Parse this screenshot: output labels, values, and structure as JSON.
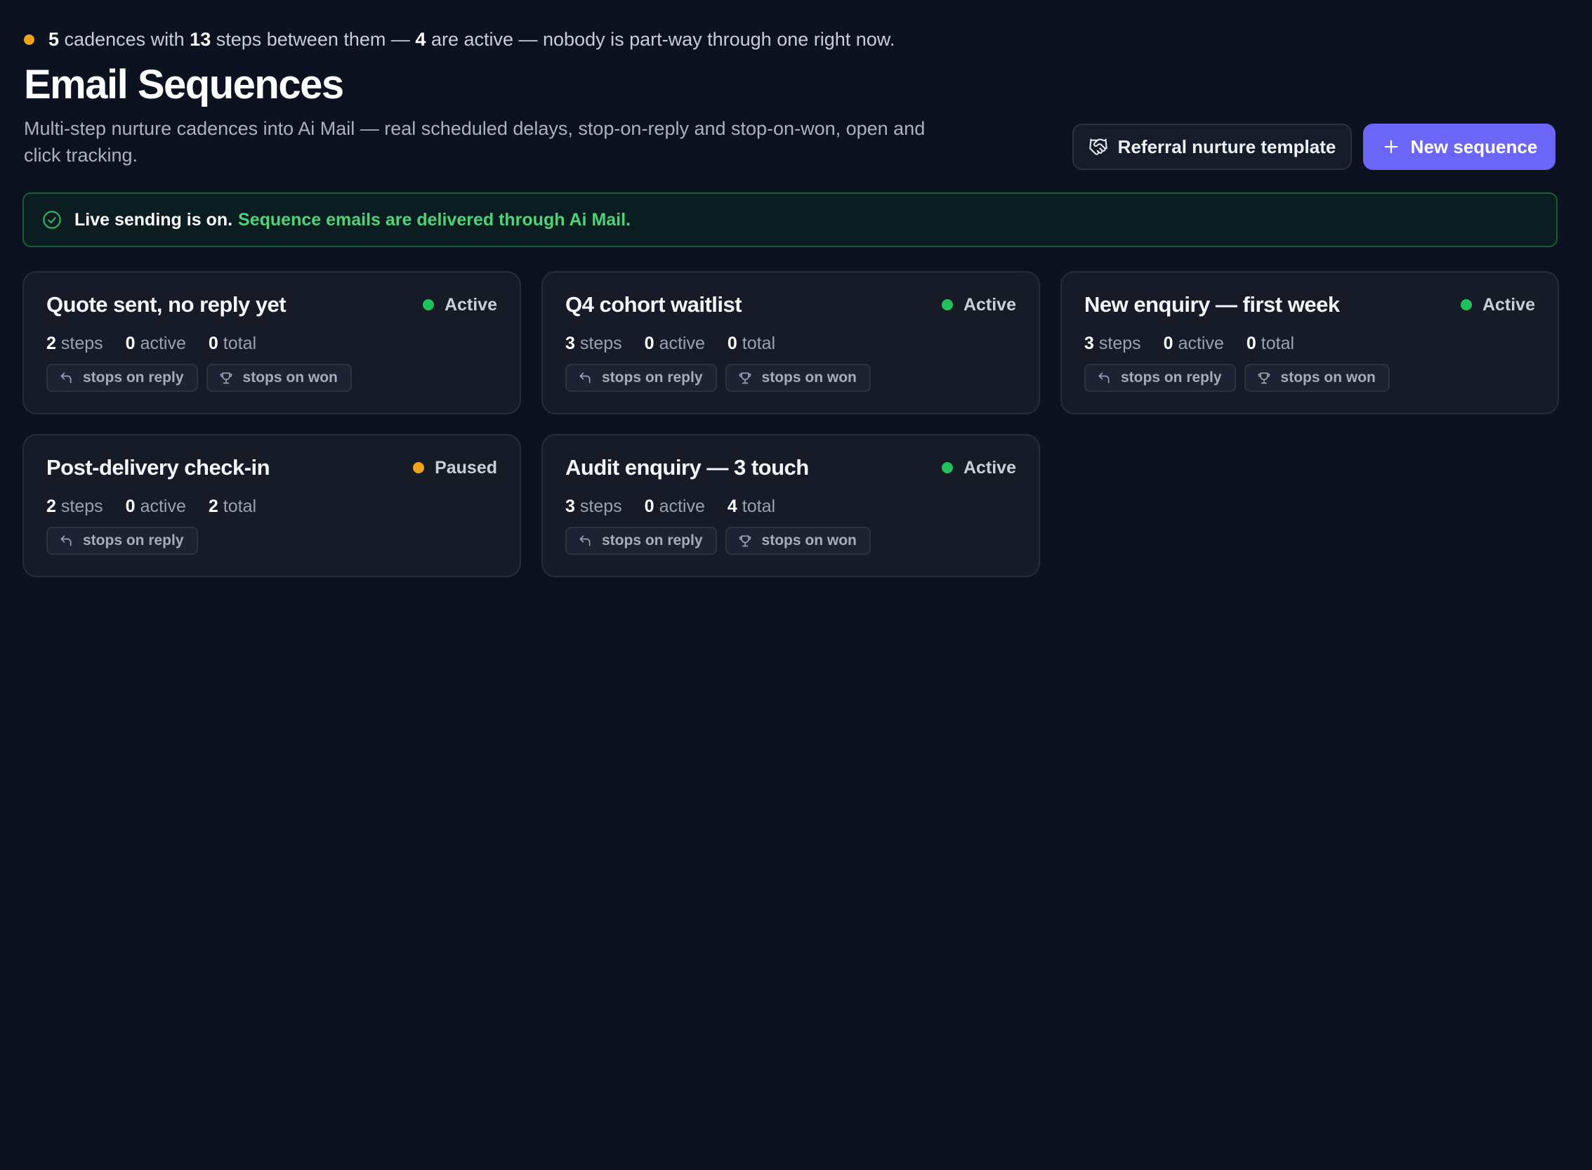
{
  "summary": {
    "cadences": "5",
    "cadences_text": "cadences with",
    "steps": "13",
    "steps_text": "steps between them —",
    "active": "4",
    "active_text": "are active — nobody is part-way through one right now.",
    "dot_color": "#f0a21a"
  },
  "header": {
    "title": "Email Sequences",
    "subtitle": "Multi-step nurture cadences into Ai Mail — real scheduled delays, stop-on-reply and stop-on-won, open and click tracking."
  },
  "actions": {
    "template_label": "Referral nurture template",
    "template_icon": "handshake-icon",
    "new_label": "New sequence",
    "new_icon": "plus-icon",
    "accent_color": "#6b66f8"
  },
  "banner": {
    "icon": "check-circle-icon",
    "strong": "Live sending is on.",
    "message": "Sequence emails are delivered through Ai Mail."
  },
  "labels": {
    "steps": "steps",
    "active": "active",
    "total": "total",
    "reply_tag": "stops on reply",
    "won_tag": "stops on won"
  },
  "status_colors": {
    "Active": "#1fc25a",
    "Paused": "#f0a21a"
  },
  "sequences": [
    {
      "name": "Quote sent, no reply yet",
      "status": "Active",
      "steps": "2",
      "active": "0",
      "total": "0",
      "stops_on_reply": true,
      "stops_on_won": true
    },
    {
      "name": "Q4 cohort waitlist",
      "status": "Active",
      "steps": "3",
      "active": "0",
      "total": "0",
      "stops_on_reply": true,
      "stops_on_won": true
    },
    {
      "name": "New enquiry — first week",
      "status": "Active",
      "steps": "3",
      "active": "0",
      "total": "0",
      "stops_on_reply": true,
      "stops_on_won": true
    },
    {
      "name": "Post-delivery check-in",
      "status": "Paused",
      "steps": "2",
      "active": "0",
      "total": "2",
      "stops_on_reply": true,
      "stops_on_won": false
    },
    {
      "name": "Audit enquiry — 3 touch",
      "status": "Active",
      "steps": "3",
      "active": "0",
      "total": "4",
      "stops_on_reply": true,
      "stops_on_won": true
    }
  ]
}
